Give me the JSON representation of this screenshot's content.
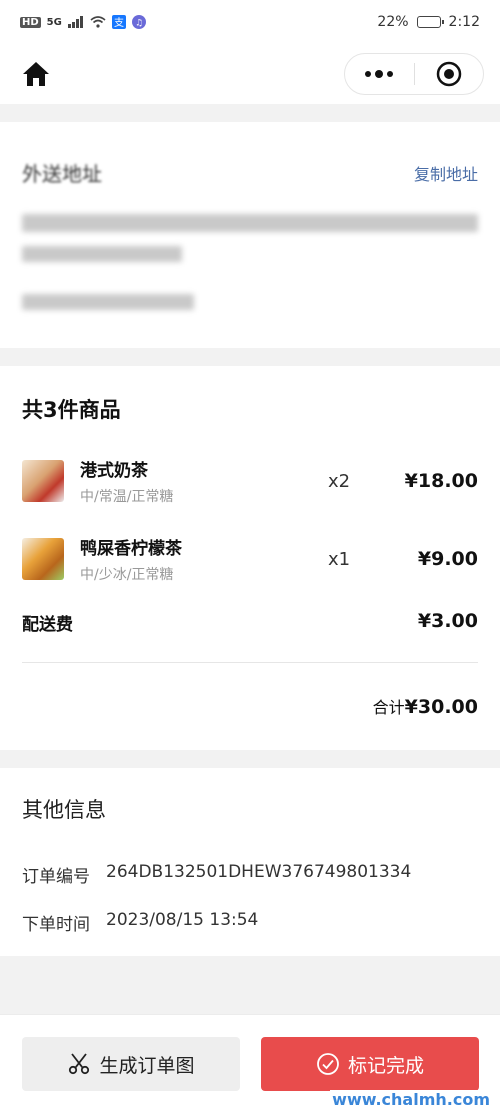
{
  "status_bar": {
    "left_labels": [
      "HD",
      "5G"
    ],
    "battery": "22%",
    "time": "2:12"
  },
  "nav": {
    "home_icon": "home-icon",
    "more_icon": "more-dots-icon",
    "close_icon": "target-close-icon"
  },
  "address": {
    "title": "外送地址",
    "copy_label": "复制地址"
  },
  "goods": {
    "title": "共3件商品",
    "items": [
      {
        "name": "港式奶茶",
        "spec": "中/常温/正常糖",
        "qty": "x2",
        "price": "¥18.00"
      },
      {
        "name": "鸭屎香柠檬茶",
        "spec": "中/少冰/正常糖",
        "qty": "x1",
        "price": "¥9.00"
      }
    ],
    "fee_label": "配送费",
    "fee_value": "¥3.00",
    "total_label": "合计",
    "total_value": "¥30.00"
  },
  "info": {
    "title": "其他信息",
    "order_no_label": "订单编号",
    "order_no": "264DB132501DHEW376749801334",
    "order_time_label": "下单时间",
    "order_time": "2023/08/15 13:54"
  },
  "actions": {
    "generate_label": "生成订单图",
    "done_label": "标记完成"
  },
  "watermark": "www.chalmh.com",
  "colors": {
    "accent": "#e84c4c",
    "link": "#4a6da7"
  }
}
